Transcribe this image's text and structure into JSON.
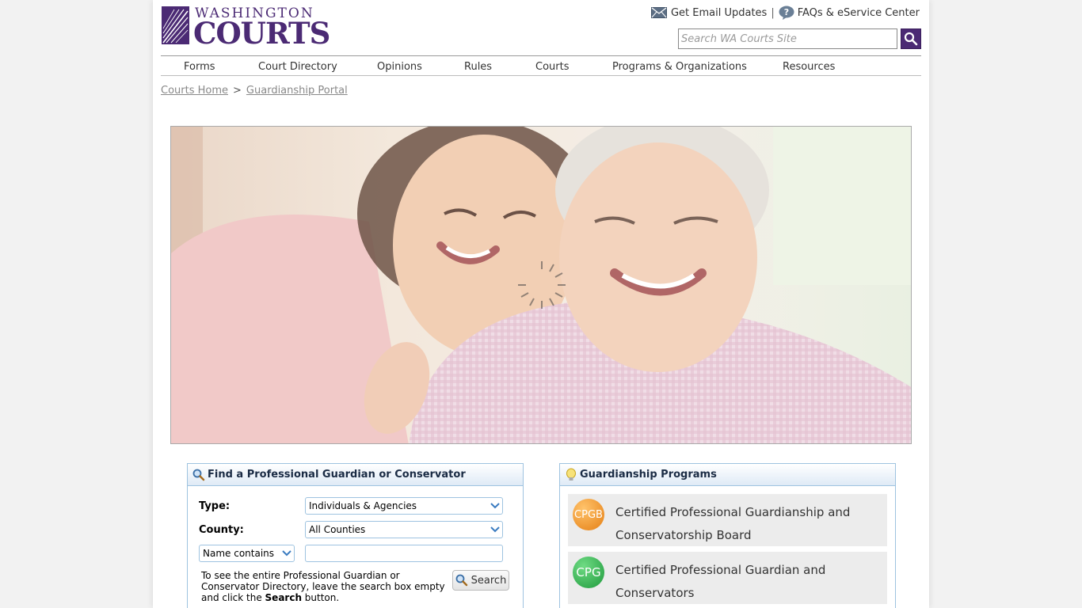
{
  "header": {
    "logo_top": "WASHINGTON",
    "logo_main": "COURTS",
    "email_link": "Get Email Updates",
    "separator": "|",
    "faq_link": "FAQs & eService Center",
    "search_placeholder": "Search WA Courts Site"
  },
  "nav": [
    "Forms",
    "Court Directory",
    "Opinions",
    "Rules",
    "Courts",
    "Programs & Organizations",
    "Resources"
  ],
  "breadcrumb": {
    "home": "Courts Home",
    "sep": ">",
    "current": "Guardianship Portal"
  },
  "find_panel": {
    "title": "Find a Professional Guardian or Conservator",
    "type_label": "Type:",
    "type_value": "Individuals & Agencies",
    "county_label": "County:",
    "county_value": "All Counties",
    "name_filter": "Name contains",
    "hint_part1": "To see the entire Professional Guardian or Conservator Directory, leave the search box empty and click the ",
    "hint_bold": "Search",
    "hint_part2": " button.",
    "search_button": "Search"
  },
  "programs_panel": {
    "title": "Guardianship Programs",
    "items": [
      {
        "badge": "CPGB",
        "label": "Certified Professional Guardianship and Conservatorship Board",
        "color": "#f0982a"
      },
      {
        "badge": "CPG",
        "label": "Certified Professional Guardian and Conservators",
        "color": "#2fae4e"
      }
    ]
  },
  "colors": {
    "brand_purple": "#4b2a74",
    "panel_border": "#9ec3e0"
  }
}
